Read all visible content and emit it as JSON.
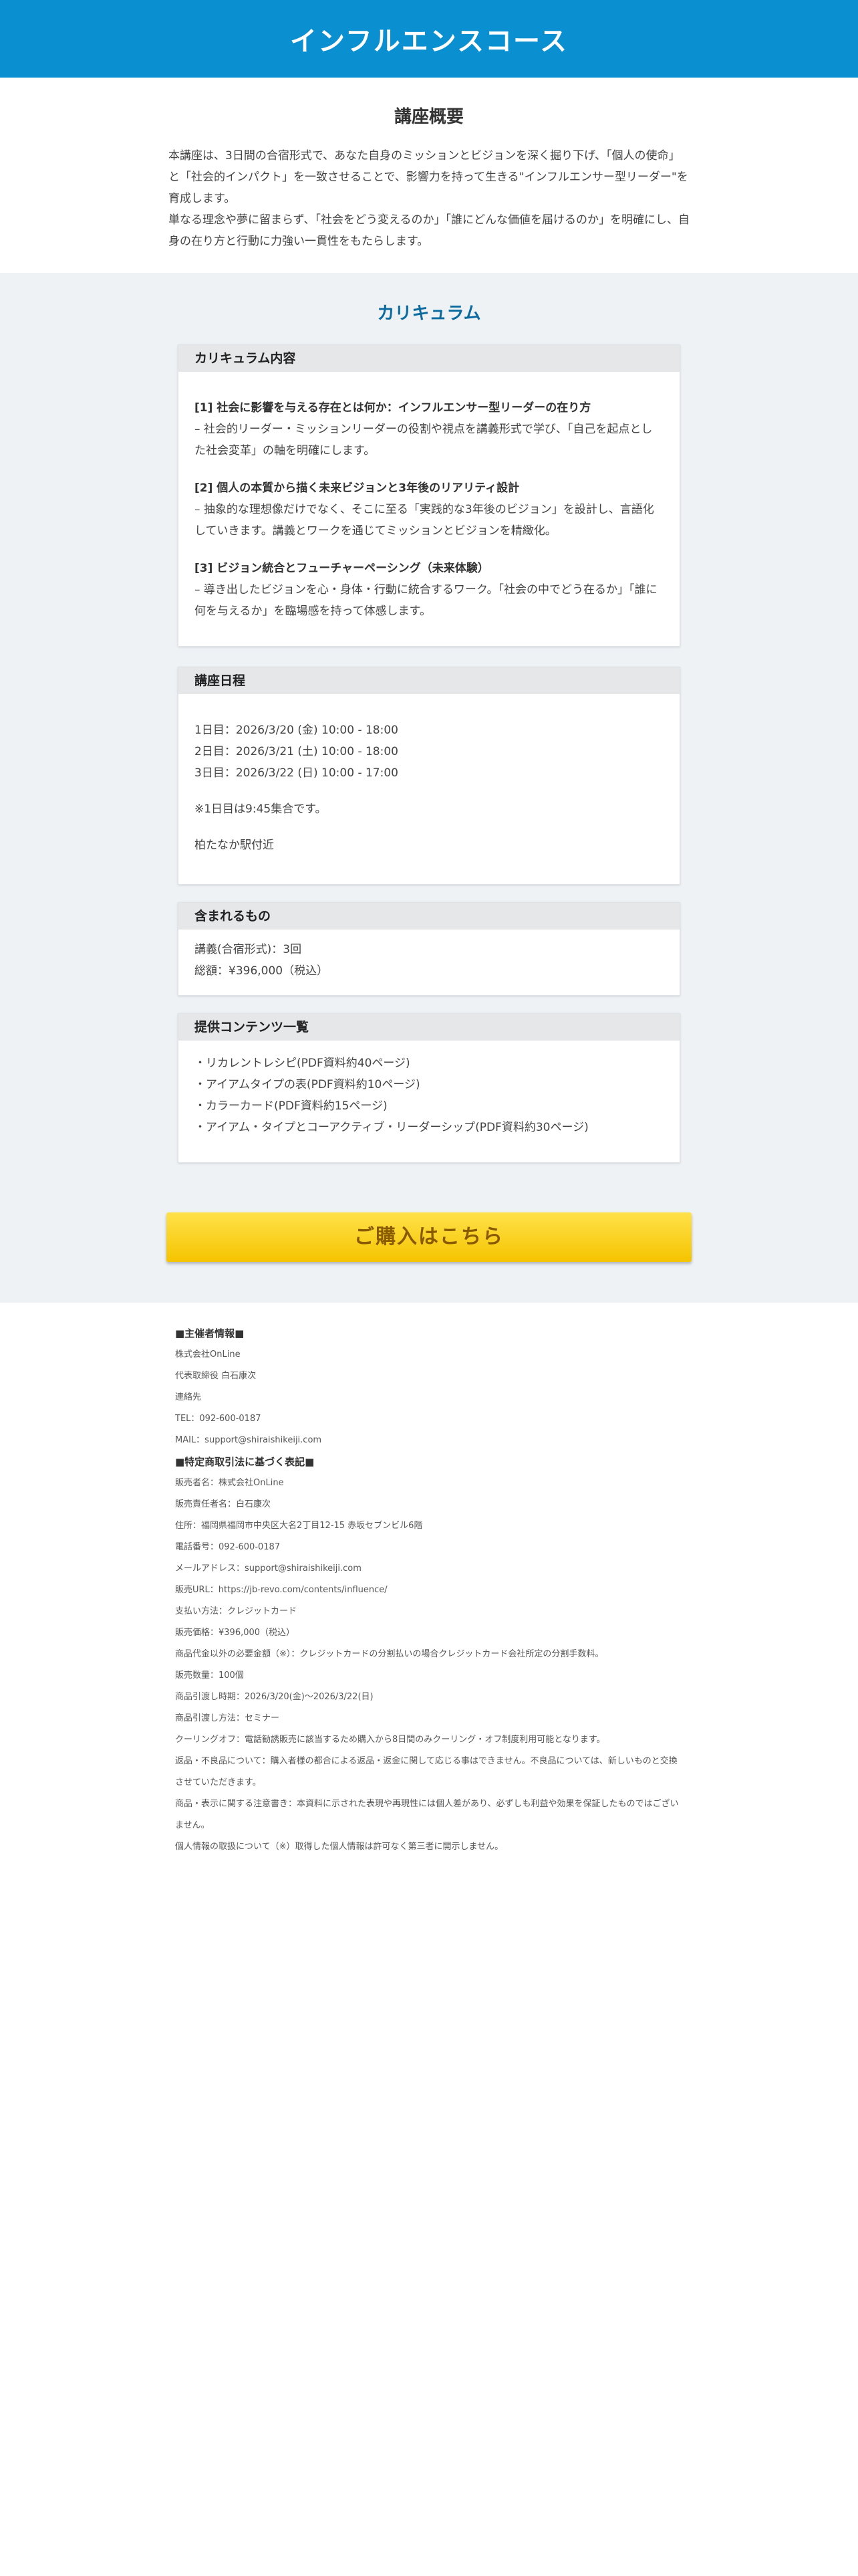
{
  "header": {
    "title": "インフルエンスコース"
  },
  "overview": {
    "title": "講座概要",
    "line1": "本講座は、3日間の合宿形式で、あなた自身のミッションとビジョンを深く掘り下げ、「個人の使命」と「社会的インパクト」を一致させることで、影響力を持って生きる\"インフルエンサー型リーダー\"を育成します。",
    "line2": "単なる理念や夢に留まらず、「社会をどう変えるのか」「誰にどんな価値を届けるのか」を明確にし、自身の在り方と行動に力強い一貫性をもたらします。"
  },
  "curriculum": {
    "title": "カリキュラム",
    "contents": {
      "heading": "カリキュラム内容",
      "items": [
        {
          "title": "[1] 社会に影響を与える存在とは何か：インフルエンサー型リーダーの在り方",
          "desc": "– 社会的リーダー・ミッションリーダーの役割や視点を講義形式で学び、「自己を起点とした社会変革」の軸を明確にします。"
        },
        {
          "title": "[2] 個人の本質から描く未来ビジョンと3年後のリアリティ設計",
          "desc": "– 抽象的な理想像だけでなく、そこに至る「実践的な3年後のビジョン」を設計し、言語化していきます。講義とワークを通じてミッションとビジョンを精緻化。"
        },
        {
          "title": "[3] ビジョン統合とフューチャーペーシング（未来体験）",
          "desc": "– 導き出したビジョンを心・身体・行動に統合するワーク。「社会の中でどう在るか」「誰に何を与えるか」を臨場感を持って体感します。"
        }
      ]
    },
    "schedule": {
      "heading": "講座日程",
      "day1": "1日目：2026/3/20 (金) 10:00 - 18:00",
      "day2": "2日目：2026/3/21 (土) 10:00 - 18:00",
      "day3": "3日目：2026/3/22 (日) 10:00 - 17:00",
      "note": "※1日目は9:45集合です。",
      "location": "柏たなか駅付近"
    },
    "included": {
      "heading": "含まれるもの",
      "line1": "講義(合宿形式)：3回",
      "line2": "総額：¥396,000（税込）"
    },
    "materials": {
      "heading": "提供コンテンツ一覧",
      "items": [
        "・リカレントレシピ(PDF資料約40ページ)",
        "・アイアムタイプの表(PDF資料約10ページ)",
        "・カラーカード(PDF資料約15ページ)",
        "・アイアム・タイプとコーアクティブ・リーダーシップ(PDF資料約30ページ)"
      ]
    },
    "buy_label": "ご購入はこちら"
  },
  "organizer": {
    "heading": "■主催者情報■",
    "lines": [
      "株式会社OnLine",
      "代表取締役 白石康次",
      "連絡先",
      "TEL：092-600-0187",
      "MAIL：support@shiraishikeiji.com"
    ]
  },
  "legal": {
    "heading": "■特定商取引法に基づく表記■",
    "lines": [
      "販売者名：株式会社OnLine",
      "販売責任者名：白石康次",
      "住所：福岡県福岡市中央区大名2丁目12-15 赤坂セブンビル6階",
      "電話番号：092-600-0187",
      "メールアドレス：support@shiraishikeiji.com",
      "販売URL：https://jb-revo.com/contents/influence/",
      "支払い方法：クレジットカード",
      "販売価格：¥396,000（税込）",
      "商品代金以外の必要金額（※）：クレジットカードの分割払いの場合クレジットカード会社所定の分割手数料。",
      "販売数量：100個",
      "商品引渡し時期：2026/3/20(金)〜2026/3/22(日)",
      "商品引渡し方法：セミナー",
      "クーリングオフ：電話勧誘販売に該当するため購入から8日間のみクーリング・オフ制度利用可能となります。",
      "返品・不良品について：購入者様の都合による返品・返金に関して応じる事はできません。不良品については、新しいものと交換させていただきます。",
      "商品・表示に関する注意書き：本資料に示された表現や再現性には個人差があり、必ずしも利益や効果を保証したものではございません。",
      "個人情報の取扱について（※）取得した個人情報は許可なく第三者に開示しません。"
    ]
  }
}
